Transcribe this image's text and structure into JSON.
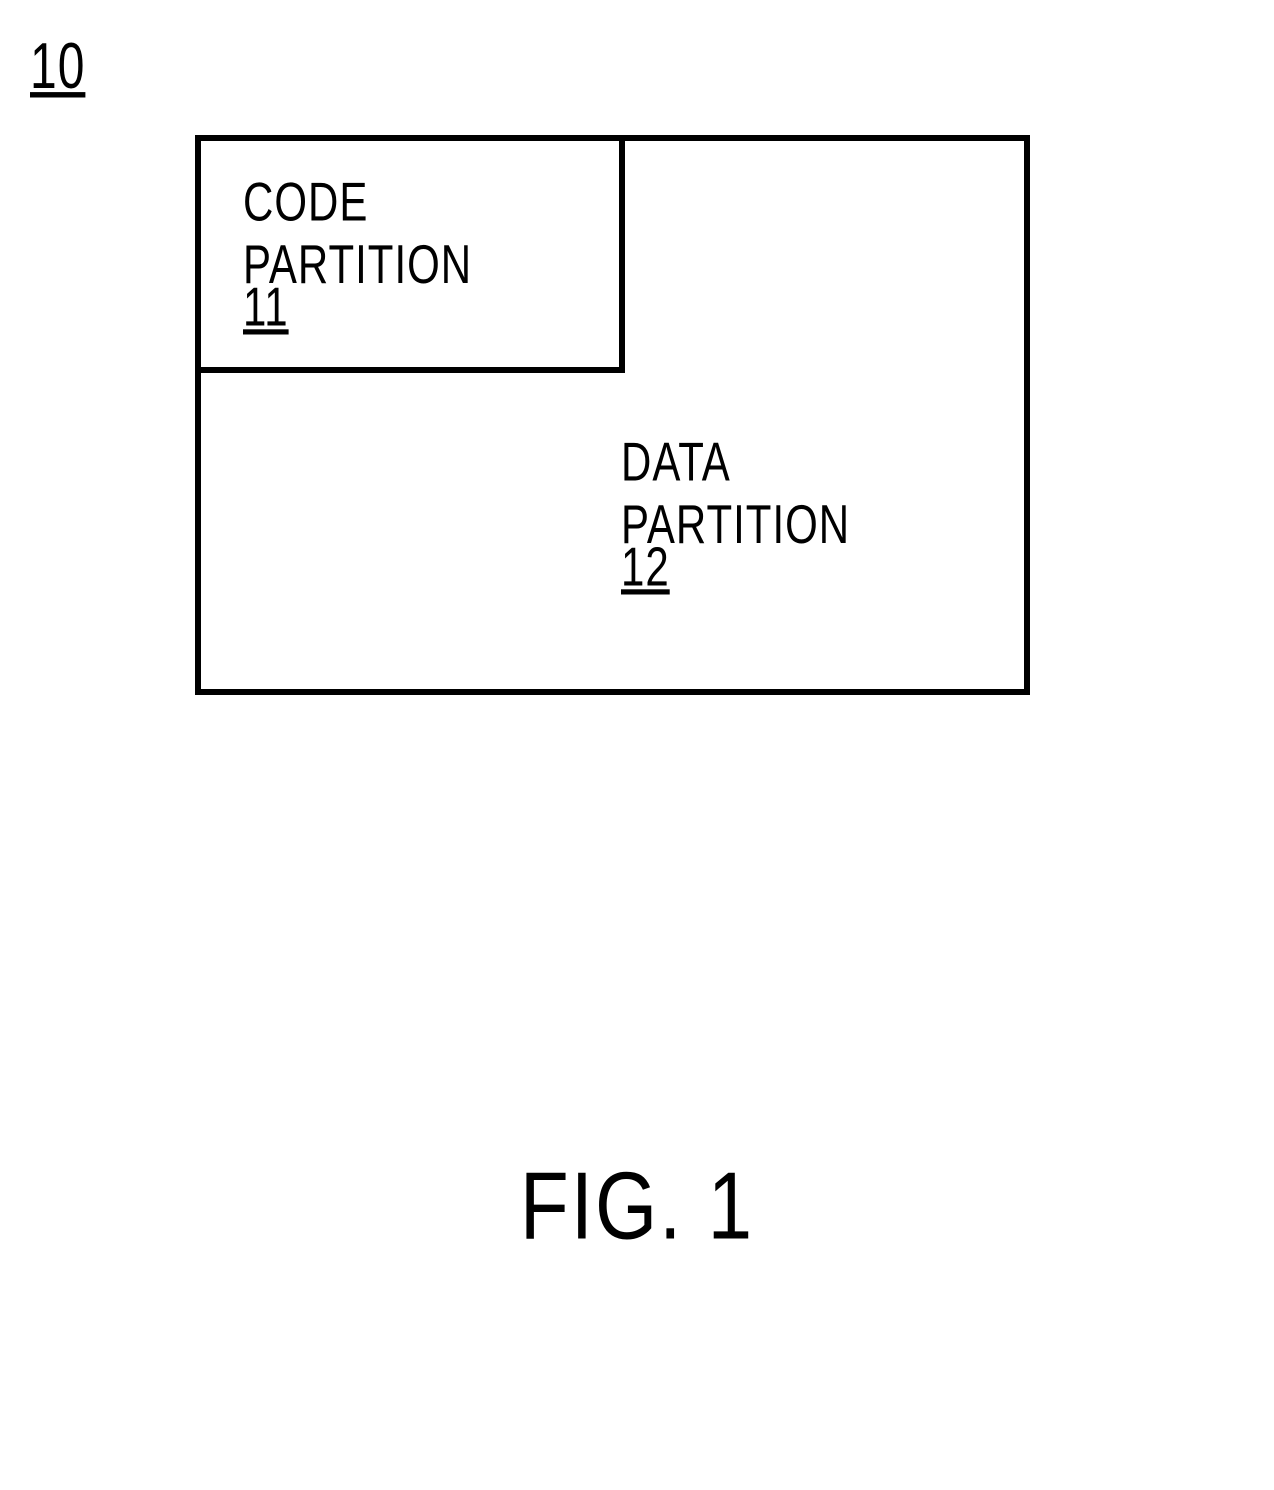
{
  "figure_ref": "10",
  "code_partition": {
    "line1": "CODE",
    "line2": "PARTITION",
    "ref": "11"
  },
  "data_partition": {
    "line1": "DATA",
    "line2": "PARTITION",
    "ref": "12"
  },
  "caption": "FIG. 1"
}
